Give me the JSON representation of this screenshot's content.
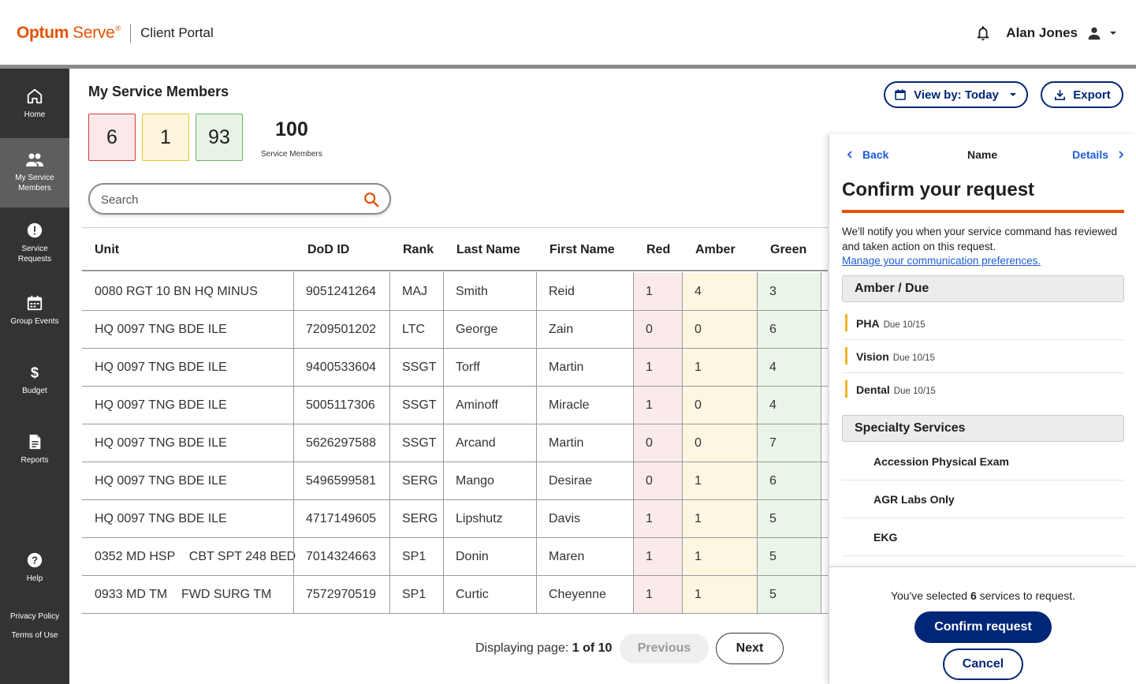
{
  "header": {
    "brand_optum": "Optum",
    "brand_serve": "Serve",
    "brand_reg": "®",
    "portal": "Client Portal",
    "user_name": "Alan Jones"
  },
  "sidebar": {
    "items": [
      {
        "label": "Home",
        "icon": "home-icon"
      },
      {
        "label": "My Service Members",
        "icon": "people-icon"
      },
      {
        "label": "Service Requests",
        "icon": "alert-circle-icon"
      },
      {
        "label": "Group Events",
        "icon": "calendar-icon"
      },
      {
        "label": "Budget",
        "icon": "dollar-icon"
      },
      {
        "label": "Reports",
        "icon": "document-icon"
      },
      {
        "label": "Help",
        "icon": "help-icon"
      }
    ],
    "footer": {
      "privacy": "Privacy Policy",
      "terms": "Terms of Use"
    }
  },
  "main": {
    "title": "My Service Members",
    "stats": {
      "red": "6",
      "amber": "1",
      "green": "93",
      "total": "100",
      "total_label": "Service Members"
    },
    "search": {
      "placeholder": "Search"
    },
    "view_by": "View by: Today",
    "export": "Export",
    "table": {
      "headers": [
        "Unit",
        "DoD ID",
        "Rank",
        "Last Name",
        "First Name",
        "Red",
        "Amber",
        "Green"
      ],
      "rows": [
        [
          "0080 RGT 10 BN HQ MINUS",
          "9051241264",
          "MAJ",
          "Smith",
          "Reid",
          "1",
          "4",
          "3"
        ],
        [
          "HQ 0097 TNG BDE ILE",
          "7209501202",
          "LTC",
          "George",
          "Zain",
          "0",
          "0",
          "6"
        ],
        [
          "HQ 0097 TNG BDE ILE",
          "9400533604",
          "SSGT",
          "Torff",
          "Martin",
          "1",
          "1",
          "4"
        ],
        [
          "HQ 0097 TNG BDE ILE",
          "5005117306",
          "SSGT",
          "Aminoff",
          "Miracle",
          "1",
          "0",
          "4"
        ],
        [
          "HQ 0097 TNG BDE ILE",
          "5626297588",
          "SSGT",
          "Arcand",
          "Martin",
          "0",
          "0",
          "7"
        ],
        [
          "HQ 0097 TNG BDE ILE",
          "5496599581",
          "SERG",
          "Mango",
          "Desirae",
          "0",
          "1",
          "6"
        ],
        [
          "HQ 0097 TNG BDE ILE",
          "4717149605",
          "SERG",
          "Lipshutz",
          "Davis",
          "1",
          "1",
          "5"
        ],
        [
          "0352 MD HSP    CBT SPT 248 BED",
          "7014324663",
          "SP1",
          "Donin",
          "Maren",
          "1",
          "1",
          "5"
        ],
        [
          "0933 MD TM    FWD SURG TM",
          "7572970519",
          "SP1",
          "Curtic",
          "Cheyenne",
          "1",
          "1",
          "5"
        ]
      ]
    },
    "pager": {
      "prefix": "Displaying page:",
      "value": "1 of 10",
      "previous": "Previous",
      "next": "Next"
    }
  },
  "panel": {
    "back": "Back",
    "name": "Name",
    "details": "Details",
    "title": "Confirm your request",
    "notice": "We'll notify you when your service command has reviewed and taken action on this request.",
    "link": "Manage your communication preferences.",
    "amber_heading": "Amber / Due",
    "due_items": [
      {
        "name": "PHA",
        "due": "Due 10/15"
      },
      {
        "name": "Vision",
        "due": "Due 10/15"
      },
      {
        "name": "Dental",
        "due": "Due 10/15"
      }
    ],
    "specialty_heading": "Specialty Services",
    "specialty_items": [
      "Accession Physical Exam",
      "AGR Labs Only",
      "EKG"
    ],
    "selection_prefix": "You've selected",
    "selection_count": "6",
    "selection_suffix": "services to request.",
    "confirm": "Confirm request",
    "cancel": "Cancel"
  },
  "colors": {
    "brand_orange": "#e35205",
    "navy": "#002677",
    "link_blue": "#1d5cd6",
    "red_bg": "#fbeaea",
    "amber_bg": "#fdf7e2",
    "green_bg": "#eaf4e8",
    "amber_bar": "#f0b323"
  }
}
